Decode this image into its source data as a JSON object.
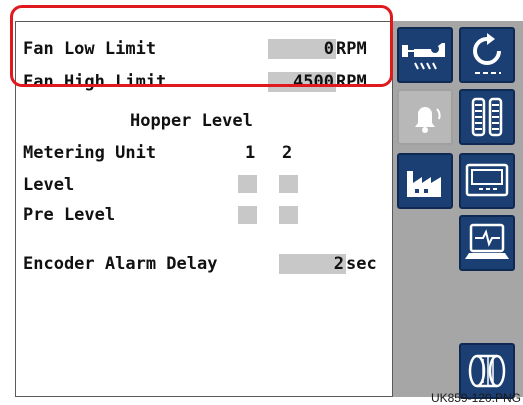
{
  "settings": {
    "fan_low_label": "Fan Low Limit",
    "fan_low_value": "0",
    "fan_low_unit": "RPM",
    "fan_high_label": "Fan High Limit",
    "fan_high_value": "4500",
    "fan_high_unit": "RPM"
  },
  "hopper": {
    "title": "Hopper Level",
    "metering_label": "Metering Unit",
    "unit_1": "1",
    "unit_2": "2",
    "level_label": "Level",
    "pre_level_label": "Pre Level"
  },
  "encoder": {
    "label": "Encoder Alarm Delay",
    "value": "2",
    "unit": "sec"
  },
  "sidebar": {
    "buttons": [
      {
        "icon": "seeder-icon"
      },
      {
        "icon": "refresh-icon"
      },
      {
        "icon": "alarm-bell-icon"
      },
      {
        "icon": "hopper-tracks-icon"
      },
      {
        "icon": "factory-icon"
      },
      {
        "icon": "display-icon"
      },
      {
        "icon": "monitor-signal-icon"
      },
      {
        "icon": "metering-roller-icon"
      }
    ]
  },
  "caption": "UK859-120.PNG",
  "colors": {
    "button_blue": "#1b3f72",
    "sidebar_gray": "#a6a6a6",
    "highlight_red": "#e0191e",
    "value_box_gray": "#c8c8c8"
  }
}
